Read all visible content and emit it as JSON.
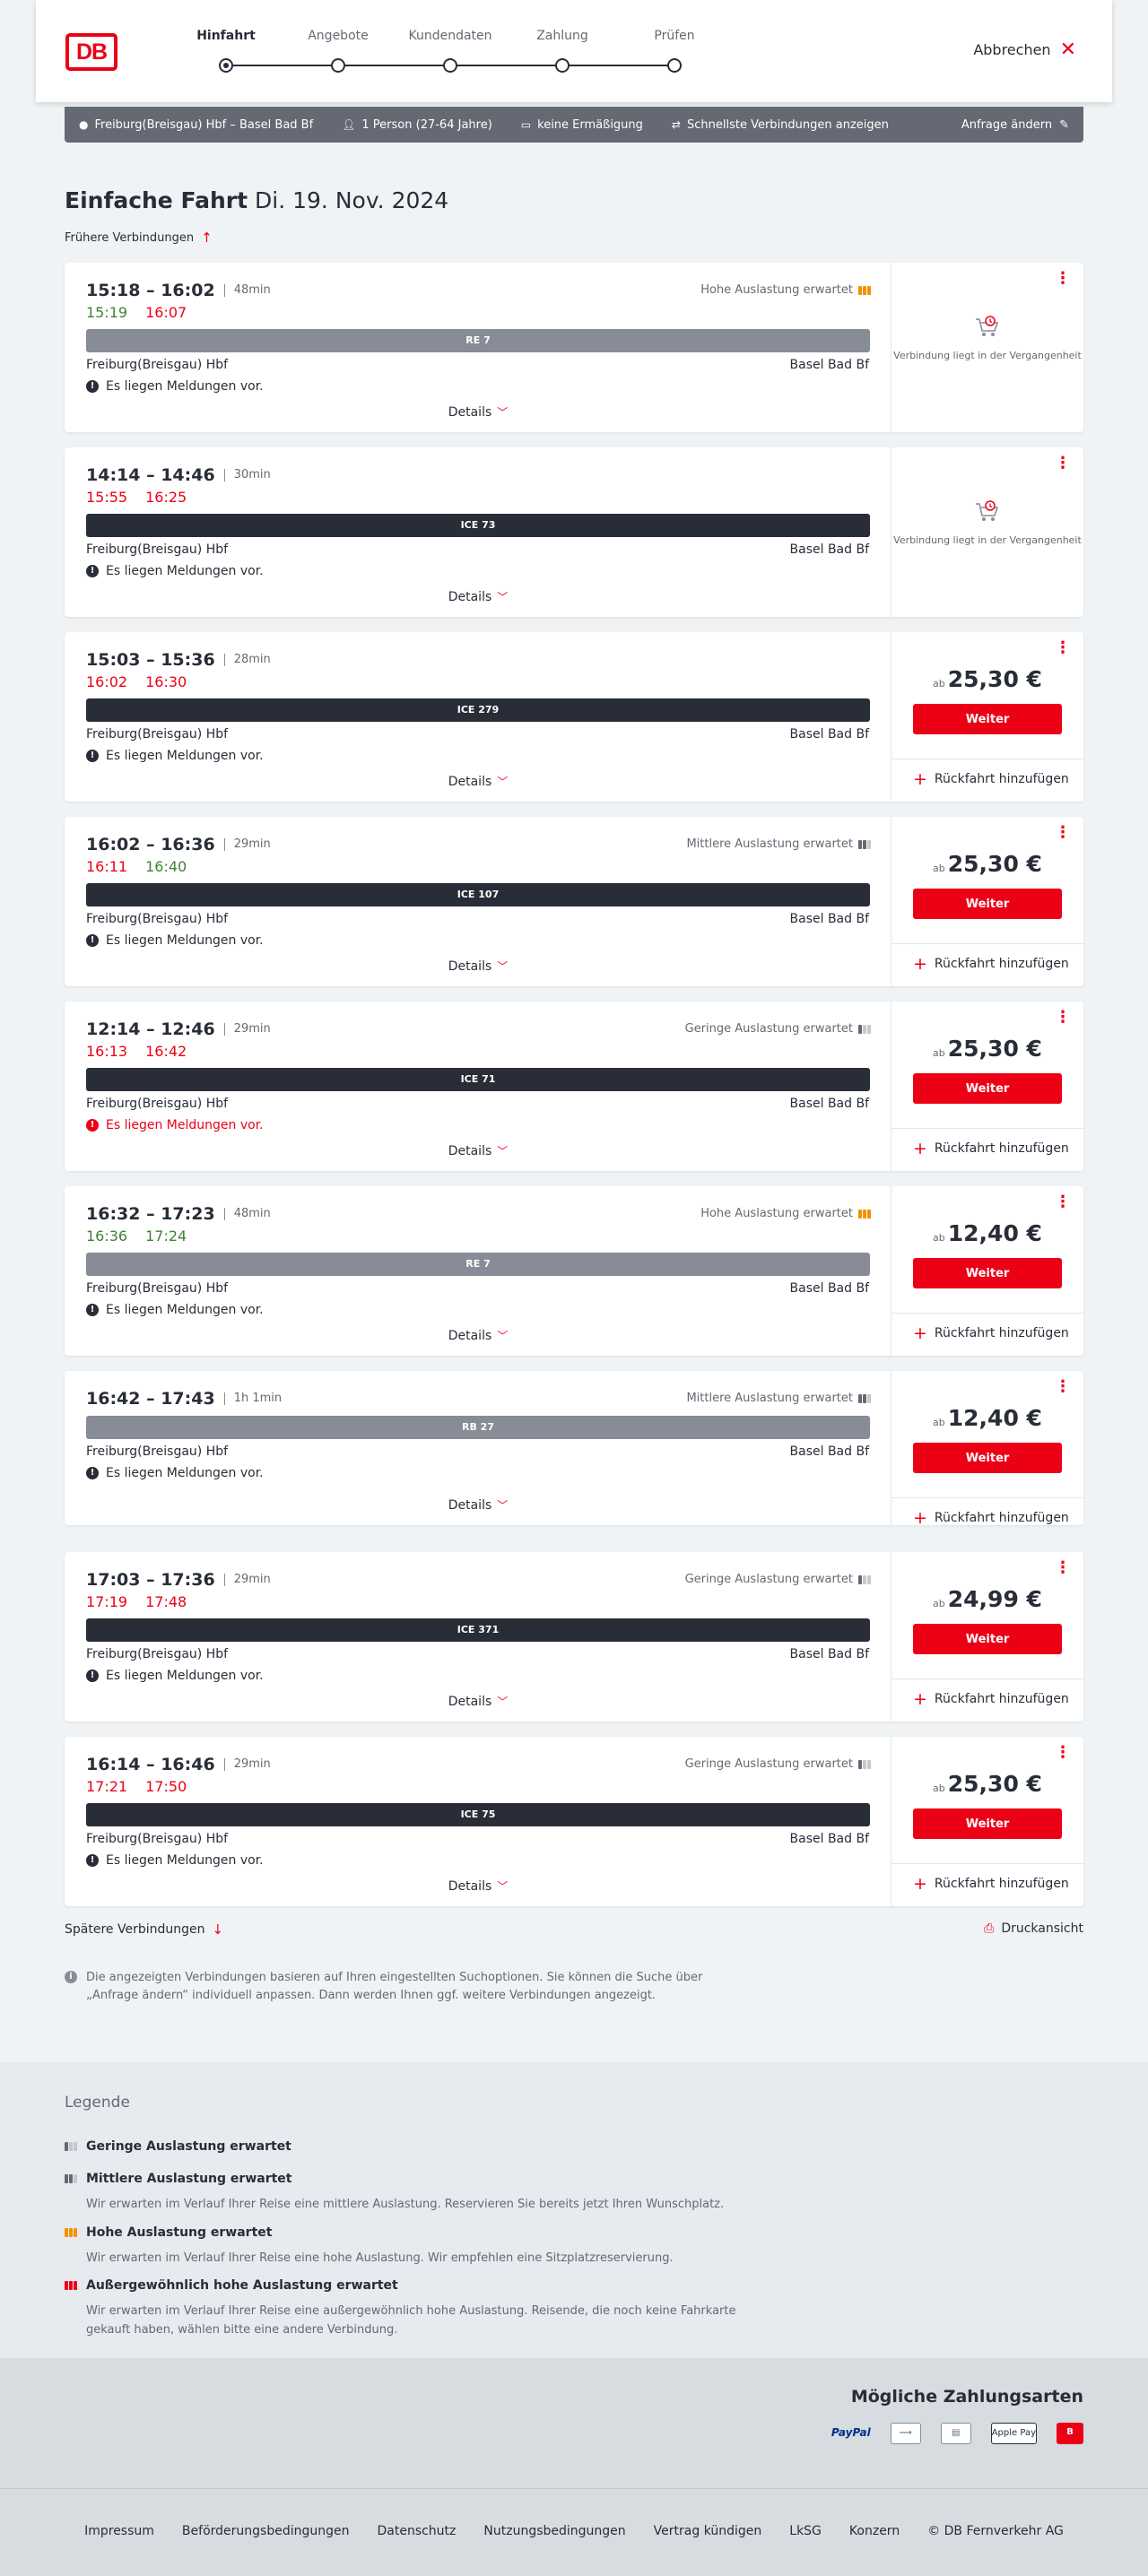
{
  "header": {
    "logo": "DB",
    "steps": [
      "Hinfahrt",
      "Angebote",
      "Kundendaten",
      "Zahlung",
      "Prüfen"
    ],
    "cancel": "Abbrechen"
  },
  "query": {
    "route": "Freiburg(Breisgau) Hbf – Basel Bad Bf",
    "persons": "1 Person (27-64 Jahre)",
    "discount": "keine Ermäßigung",
    "fastest": "Schnellste Verbindungen anzeigen",
    "edit": "Anfrage ändern"
  },
  "title": {
    "type": "Einfache Fahrt",
    "date": "Di. 19. Nov. 2024"
  },
  "earlier": "Frühere Verbindungen",
  "later": "Spätere Verbindungen",
  "print": "Druckansicht",
  "connections": [
    {
      "times": "15:18 – 16:02",
      "duration": "48min",
      "rt_dep": "15:19",
      "rt_arr": "16:07",
      "rt_dep_color": "green",
      "rt_arr_color": "red",
      "load": "Hohe Auslastung erwartet",
      "load_level": 3,
      "train": "RE 7",
      "train_style": "grey",
      "from": "Freiburg(Breisgau) Hbf",
      "to": "Basel Bad Bf",
      "message": "Es liegen Meldungen vor.",
      "message_alert": false,
      "details": "Details",
      "past": true,
      "past_text": "Verbindung liegt in der Vergangenheit"
    },
    {
      "times": "14:14 – 14:46",
      "duration": "30min",
      "rt_dep": "15:55",
      "rt_arr": "16:25",
      "rt_dep_color": "red",
      "rt_arr_color": "red",
      "load": "",
      "load_level": 0,
      "train": "ICE 73",
      "train_style": "dark",
      "from": "Freiburg(Breisgau) Hbf",
      "to": "Basel Bad Bf",
      "message": "Es liegen Meldungen vor.",
      "message_alert": false,
      "details": "Details",
      "past": true,
      "past_text": "Verbindung liegt in der Vergangenheit"
    },
    {
      "times": "15:03 – 15:36",
      "duration": "28min",
      "rt_dep": "16:02",
      "rt_arr": "16:30",
      "rt_dep_color": "red",
      "rt_arr_color": "red",
      "load": "",
      "load_level": 0,
      "train": "ICE 279",
      "train_style": "dark",
      "from": "Freiburg(Breisgau) Hbf",
      "to": "Basel Bad Bf",
      "message": "Es liegen Meldungen vor.",
      "message_alert": false,
      "details": "Details",
      "past": false,
      "price_prefix": "ab",
      "price": "25,30 €",
      "continue": "Weiter",
      "return": "Rückfahrt hinzufügen"
    },
    {
      "times": "16:02 – 16:36",
      "duration": "29min",
      "rt_dep": "16:11",
      "rt_arr": "16:40",
      "rt_dep_color": "red",
      "rt_arr_color": "green",
      "load": "Mittlere Auslastung erwartet",
      "load_level": 2,
      "train": "ICE 107",
      "train_style": "dark",
      "from": "Freiburg(Breisgau) Hbf",
      "to": "Basel Bad Bf",
      "message": "Es liegen Meldungen vor.",
      "message_alert": false,
      "details": "Details",
      "past": false,
      "price_prefix": "ab",
      "price": "25,30 €",
      "continue": "Weiter",
      "return": "Rückfahrt hinzufügen"
    },
    {
      "times": "12:14 – 12:46",
      "duration": "29min",
      "rt_dep": "16:13",
      "rt_arr": "16:42",
      "rt_dep_color": "red",
      "rt_arr_color": "red",
      "load": "Geringe Auslastung erwartet",
      "load_level": 1,
      "train": "ICE 71",
      "train_style": "dark",
      "from": "Freiburg(Breisgau) Hbf",
      "to": "Basel Bad Bf",
      "message": "Es liegen Meldungen vor.",
      "message_alert": true,
      "details": "Details",
      "past": false,
      "price_prefix": "ab",
      "price": "25,30 €",
      "continue": "Weiter",
      "return": "Rückfahrt hinzufügen"
    },
    {
      "times": "16:32 – 17:23",
      "duration": "48min",
      "rt_dep": "16:36",
      "rt_arr": "17:24",
      "rt_dep_color": "green",
      "rt_arr_color": "green",
      "load": "Hohe Auslastung erwartet",
      "load_level": 3,
      "train": "RE 7",
      "train_style": "grey",
      "from": "Freiburg(Breisgau) Hbf",
      "to": "Basel Bad Bf",
      "message": "Es liegen Meldungen vor.",
      "message_alert": false,
      "details": "Details",
      "past": false,
      "price_prefix": "ab",
      "price": "12,40 €",
      "continue": "Weiter",
      "return": "Rückfahrt hinzufügen"
    },
    {
      "times": "16:42 – 17:43",
      "duration": "1h 1min",
      "rt_dep": "",
      "rt_arr": "",
      "rt_dep_color": "",
      "rt_arr_color": "",
      "load": "Mittlere Auslastung erwartet",
      "load_level": 2,
      "train": "RB 27",
      "train_style": "grey",
      "from": "Freiburg(Breisgau) Hbf",
      "to": "Basel Bad Bf",
      "message": "Es liegen Meldungen vor.",
      "message_alert": false,
      "details": "Details",
      "past": false,
      "price_prefix": "ab",
      "price": "12,40 €",
      "continue": "Weiter",
      "return": "Rückfahrt hinzufügen"
    },
    {
      "times": "17:03 – 17:36",
      "duration": "29min",
      "rt_dep": "17:19",
      "rt_arr": "17:48",
      "rt_dep_color": "red",
      "rt_arr_color": "red",
      "load": "Geringe Auslastung erwartet",
      "load_level": 1,
      "train": "ICE 371",
      "train_style": "dark",
      "from": "Freiburg(Breisgau) Hbf",
      "to": "Basel Bad Bf",
      "message": "Es liegen Meldungen vor.",
      "message_alert": false,
      "details": "Details",
      "past": false,
      "price_prefix": "ab",
      "price": "24,99 €",
      "continue": "Weiter",
      "return": "Rückfahrt hinzufügen"
    },
    {
      "times": "16:14 – 16:46",
      "duration": "29min",
      "rt_dep": "17:21",
      "rt_arr": "17:50",
      "rt_dep_color": "red",
      "rt_arr_color": "red",
      "load": "Geringe Auslastung erwartet",
      "load_level": 1,
      "train": "ICE 75",
      "train_style": "dark",
      "from": "Freiburg(Breisgau) Hbf",
      "to": "Basel Bad Bf",
      "message": "Es liegen Meldungen vor.",
      "message_alert": false,
      "details": "Details",
      "past": false,
      "price_prefix": "ab",
      "price": "25,30 €",
      "continue": "Weiter",
      "return": "Rückfahrt hinzufügen"
    }
  ],
  "info": "Die angezeigten Verbindungen basieren auf Ihren eingestellten Suchoptionen. Sie können die Suche über „Anfrage ändern“ individuell anpassen. Dann werden Ihnen ggf. weitere Verbindungen angezeigt.",
  "legend": {
    "title": "Legende",
    "items": [
      {
        "title": "Geringe Auslastung erwartet",
        "desc": ""
      },
      {
        "title": "Mittlere Auslastung erwartet",
        "desc": "Wir erwarten im Verlauf Ihrer Reise eine mittlere Auslastung. Reservieren Sie bereits jetzt Ihren Wunschplatz."
      },
      {
        "title": "Hohe Auslastung erwartet",
        "desc": "Wir erwarten im Verlauf Ihrer Reise eine hohe Auslastung. Wir empfehlen eine Sitzplatzreservierung."
      },
      {
        "title": "Außergewöhnlich hohe Auslastung erwartet",
        "desc": "Wir erwarten im Verlauf Ihrer Reise eine außergewöhnlich hohe Auslastung. Reisende, die noch keine Fahrkarte gekauft haben, wählen bitte eine andere Verbindung."
      }
    ]
  },
  "payment": {
    "title": "Mögliche Zahlungsarten",
    "methods": [
      "PayPal",
      "SEPA",
      "Kreditkarte",
      "Apple Pay",
      "DB"
    ]
  },
  "footer": [
    "Impressum",
    "Beförderungsbedingungen",
    "Datenschutz",
    "Nutzungsbedingungen",
    "Vertrag kündigen",
    "LkSG",
    "Konzern",
    "© DB Fernverkehr AG"
  ],
  "colors": {
    "accent": "#ec0016",
    "green": "#408335",
    "dark": "#282d37"
  }
}
